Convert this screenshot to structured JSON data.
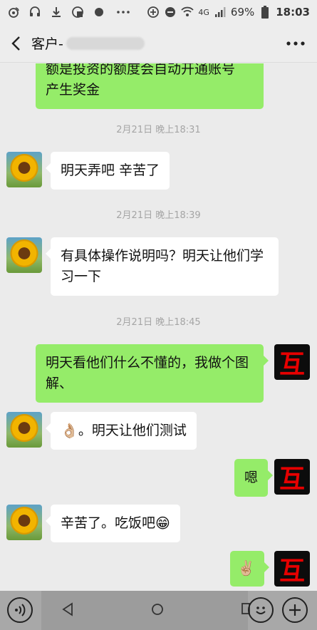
{
  "status_bar": {
    "battery": "69%",
    "time": "18:03",
    "network": "4G"
  },
  "nav": {
    "title": "客户-"
  },
  "messages": [
    {
      "side": "right",
      "text": "额是投资的额度会自动开通账号产生奖金",
      "visible_text": "产生奖金"
    },
    {
      "side": "left",
      "text": "明天弄吧 辛苦了"
    },
    {
      "side": "left",
      "text": "有具体操作说明吗？明天让他们学习一下"
    },
    {
      "side": "right",
      "text": "明天看他们什么不懂的，我做个图解、"
    },
    {
      "side": "left",
      "text": "。明天让他们测试",
      "emoji": "👌🏼"
    },
    {
      "side": "right",
      "text": "嗯"
    },
    {
      "side": "left",
      "text": "辛苦了。吃饭吧",
      "emoji_after": "😁"
    },
    {
      "side": "right",
      "text": "",
      "emoji": "✌🏼"
    }
  ],
  "timestamps": [
    "2月21日 晚上18:31",
    "2月21日 晚上18:39",
    "2月21日 晚上18:45"
  ],
  "top_partial_line": "额是投资的额度会自动开通账号",
  "avatar_mine_glyph": "互",
  "colors": {
    "bubble_me": "#95ec69",
    "bubble_other": "#ffffff",
    "chat_bg": "#ebebeb"
  }
}
